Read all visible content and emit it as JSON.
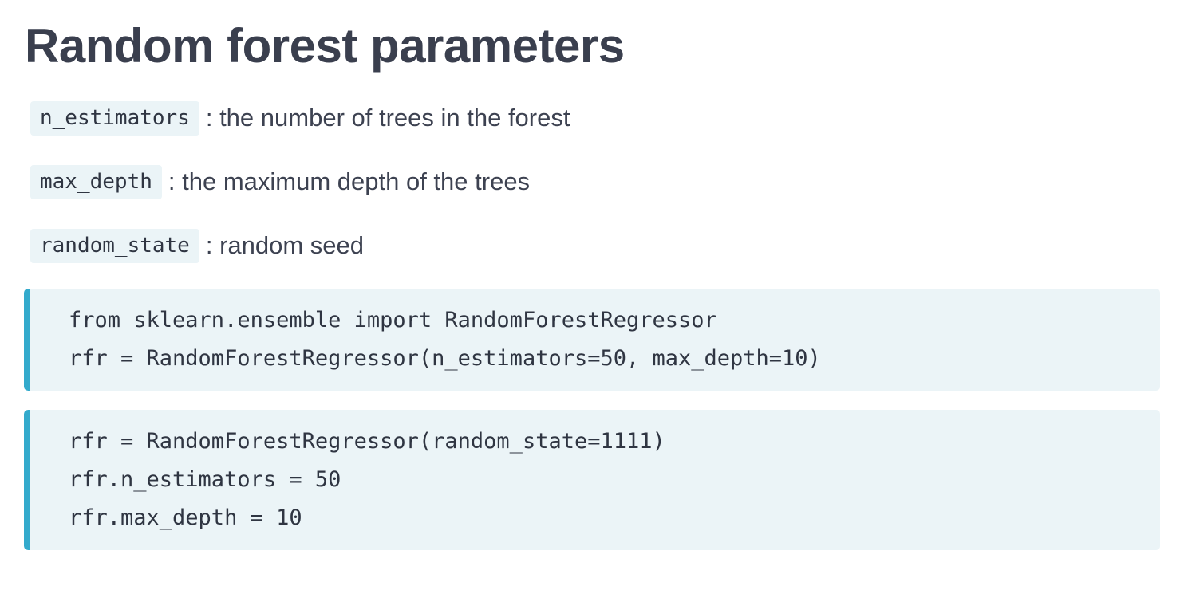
{
  "page": {
    "title": "Random forest parameters"
  },
  "parameters": [
    {
      "name": "n_estimators",
      "description": ": the number of trees in the forest"
    },
    {
      "name": "max_depth",
      "description": ": the maximum depth of the trees"
    },
    {
      "name": "random_state",
      "description": ": random seed"
    }
  ],
  "code_blocks": [
    {
      "lines": [
        "from sklearn.ensemble import RandomForestRegressor",
        "rfr = RandomForestRegressor(n_estimators=50, max_depth=10)"
      ]
    },
    {
      "lines": [
        "rfr = RandomForestRegressor(random_state=1111)",
        "rfr.n_estimators = 50",
        "rfr.max_depth = 10"
      ]
    }
  ],
  "colors": {
    "text": "#3d4251",
    "code_background": "#ebf4f7",
    "code_accent_bar": "#33aacc"
  }
}
